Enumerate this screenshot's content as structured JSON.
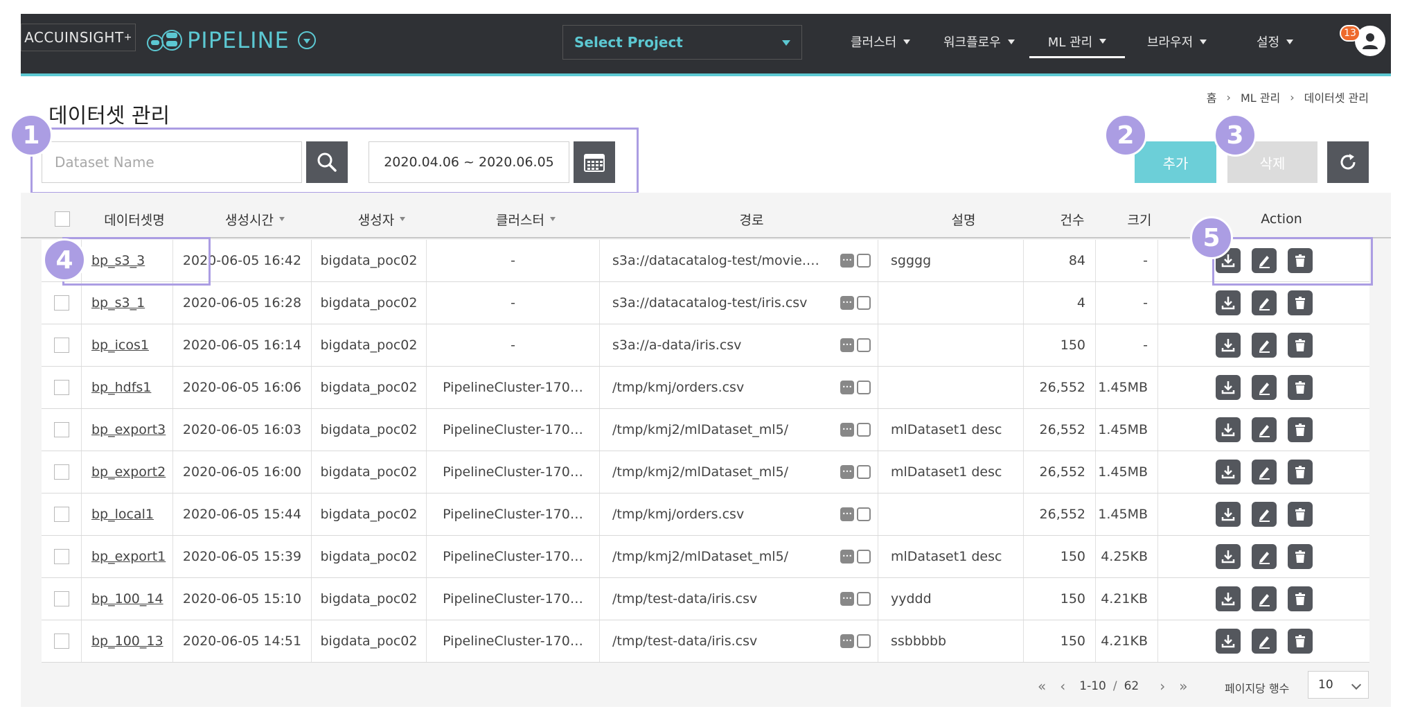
{
  "header": {
    "brand": "ACCUINSIGHT",
    "brand_mark": "+",
    "product": "PIPELINE",
    "project_select": "Select Project",
    "nav": [
      "클러스터",
      "워크플로우",
      "ML 관리",
      "브라우저",
      "설정"
    ],
    "active_nav": "ML 관리",
    "notification_count": "13",
    "accent_color": "#5cc8d2"
  },
  "breadcrumb": [
    "홈",
    "ML 관리",
    "데이터셋 관리"
  ],
  "page_title": "데이터셋 관리",
  "search": {
    "placeholder": "Dataset Name",
    "value": "",
    "date_range": "2020.04.06 ~ 2020.06.05"
  },
  "buttons": {
    "add": "추가",
    "delete": "삭제"
  },
  "markers": [
    "1",
    "2",
    "3",
    "4",
    "5"
  ],
  "table": {
    "columns": [
      "데이터셋명",
      "생성시간",
      "생성자",
      "클러스터",
      "경로",
      "설명",
      "건수",
      "크기",
      "Action"
    ],
    "rows": [
      {
        "name": "bp_s3_3",
        "created": "2020-06-05 16:42",
        "creator": "bigdata_poc02",
        "cluster": "-",
        "path": "s3a://datacatalog-test/movie.…",
        "desc": "sgggg",
        "count": "84",
        "size": "-"
      },
      {
        "name": "bp_s3_1",
        "created": "2020-06-05 16:28",
        "creator": "bigdata_poc02",
        "cluster": "-",
        "path": "s3a://datacatalog-test/iris.csv",
        "desc": "",
        "count": "4",
        "size": "-"
      },
      {
        "name": "bp_icos1",
        "created": "2020-06-05 16:14",
        "creator": "bigdata_poc02",
        "cluster": "-",
        "path": "s3a://a-data/iris.csv",
        "desc": "",
        "count": "150",
        "size": "-"
      },
      {
        "name": "bp_hdfs1",
        "created": "2020-06-05 16:06",
        "creator": "bigdata_poc02",
        "cluster": "PipelineCluster-170…",
        "path": "/tmp/kmj/orders.csv",
        "desc": "",
        "count": "26,552",
        "size": "1.45MB"
      },
      {
        "name": "bp_export3",
        "created": "2020-06-05 16:03",
        "creator": "bigdata_poc02",
        "cluster": "PipelineCluster-170…",
        "path": "/tmp/kmj2/mlDataset_ml5/",
        "desc": "mlDataset1 desc",
        "count": "26,552",
        "size": "1.45MB"
      },
      {
        "name": "bp_export2",
        "created": "2020-06-05 16:00",
        "creator": "bigdata_poc02",
        "cluster": "PipelineCluster-170…",
        "path": "/tmp/kmj2/mlDataset_ml5/",
        "desc": "mlDataset1 desc",
        "count": "26,552",
        "size": "1.45MB"
      },
      {
        "name": "bp_local1",
        "created": "2020-06-05 15:44",
        "creator": "bigdata_poc02",
        "cluster": "PipelineCluster-170…",
        "path": "/tmp/kmj/orders.csv",
        "desc": "",
        "count": "26,552",
        "size": "1.45MB"
      },
      {
        "name": "bp_export1",
        "created": "2020-06-05 15:39",
        "creator": "bigdata_poc02",
        "cluster": "PipelineCluster-170…",
        "path": "/tmp/kmj2/mlDataset_ml5/",
        "desc": "mlDataset1 desc",
        "count": "150",
        "size": "4.25KB"
      },
      {
        "name": "bp_100_14",
        "created": "2020-06-05 15:10",
        "creator": "bigdata_poc02",
        "cluster": "PipelineCluster-170…",
        "path": "/tmp/test-data/iris.csv",
        "desc": "yyddd",
        "count": "150",
        "size": "4.21KB"
      },
      {
        "name": "bp_100_13",
        "created": "2020-06-05 14:51",
        "creator": "bigdata_poc02",
        "cluster": "PipelineCluster-170…",
        "path": "/tmp/test-data/iris.csv",
        "desc": "ssbbbbb",
        "count": "150",
        "size": "4.21KB"
      }
    ]
  },
  "pagination": {
    "range": "1-10",
    "separator": "/",
    "total": "62",
    "per_page_label": "페이지당 행수",
    "per_page": "10"
  }
}
